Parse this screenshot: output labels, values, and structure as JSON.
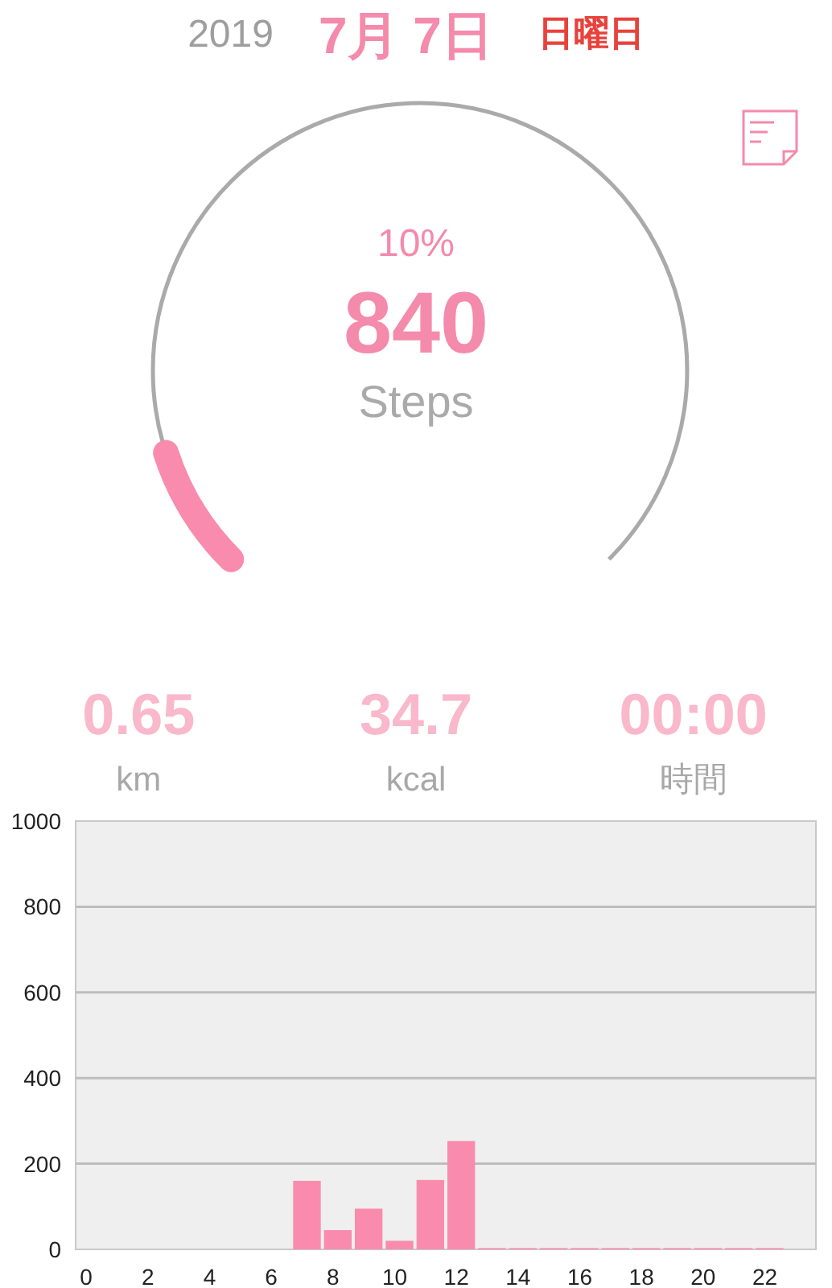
{
  "header": {
    "year": "2019",
    "date": "7月 7日",
    "weekday": "日曜日"
  },
  "gauge": {
    "percent": "10%",
    "steps": "840",
    "unit": "Steps"
  },
  "stats": [
    {
      "value": "0.65",
      "unit": "km"
    },
    {
      "value": "34.7",
      "unit": "kcal"
    },
    {
      "value": "00:00",
      "unit": "時間"
    }
  ],
  "chart_data": {
    "type": "bar",
    "x": [
      0,
      1,
      2,
      3,
      4,
      5,
      6,
      7,
      8,
      9,
      10,
      11,
      12,
      13,
      14,
      15,
      16,
      17,
      18,
      19,
      20,
      21,
      22,
      23
    ],
    "grid": true,
    "xlim": [
      -0.5,
      23.5
    ],
    "series": [
      {
        "color": "#f98bae",
        "values": [
          0,
          0,
          0,
          0,
          0,
          0,
          0,
          160,
          45,
          95,
          20,
          162,
          253,
          3,
          3,
          3,
          3,
          3,
          3,
          3,
          3,
          3,
          3,
          0
        ]
      }
    ],
    "ylim": [
      0,
      1000
    ],
    "yticks": [
      0,
      200,
      400,
      600,
      800,
      1000
    ],
    "xticks": [
      0,
      2,
      4,
      6,
      8,
      10,
      12,
      14,
      16,
      18,
      20,
      22
    ]
  }
}
